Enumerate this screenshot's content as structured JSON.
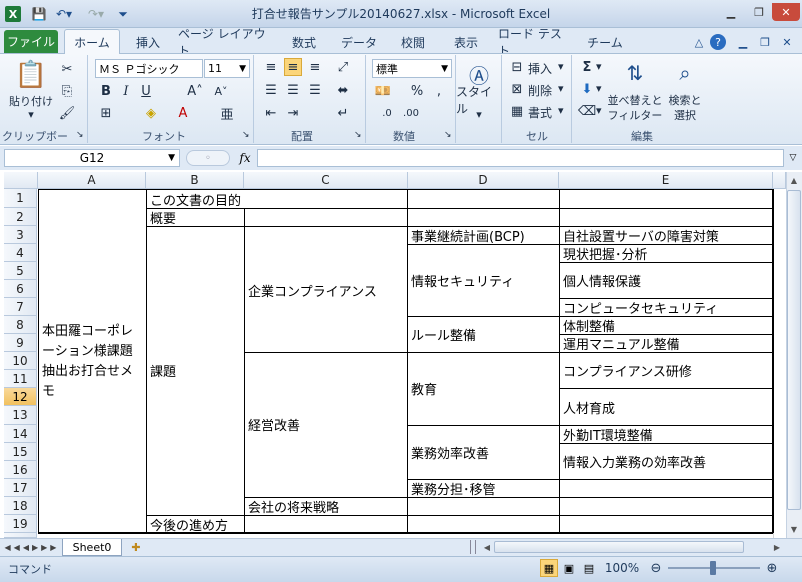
{
  "window": {
    "title": "打合せ報告サンプル20140627.xlsx - Microsoft Excel"
  },
  "ribbon_tabs": [
    "ファイル",
    "ホーム",
    "挿入",
    "ページ レイアウト",
    "数式",
    "データ",
    "校閲",
    "表示",
    "ロード テスト",
    "チーム"
  ],
  "ribbon": {
    "clipboard": {
      "label": "クリップボード",
      "paste": "貼り付け"
    },
    "font": {
      "label": "フォント",
      "name": "ＭＳ Ｐゴシック",
      "size": "11"
    },
    "alignment": {
      "label": "配置"
    },
    "number": {
      "label": "数値",
      "format": "標準"
    },
    "style": {
      "label": "スタイル",
      "button": "スタイル"
    },
    "cells": {
      "label": "セル",
      "insert": "挿入",
      "delete": "削除",
      "format": "書式"
    },
    "editing": {
      "label": "編集",
      "sort_line1": "並べ替えと",
      "sort_line2": "フィルター",
      "find_line1": "検索と",
      "find_line2": "選択"
    }
  },
  "formula_bar": {
    "name_box": "G12",
    "fx": "fx",
    "content": ""
  },
  "columns": [
    "A",
    "B",
    "C",
    "D",
    "E"
  ],
  "rows": [
    "1",
    "2",
    "3",
    "4",
    "5",
    "6",
    "7",
    "8",
    "9",
    "10",
    "11",
    "12",
    "13",
    "14",
    "15",
    "16",
    "17",
    "18",
    "19"
  ],
  "selected_row": "12",
  "cells": {
    "a_merged": "本田羅コーポレーション様課題抽出お打合せメモ",
    "b1": "この文書の目的",
    "b2": "概要",
    "b_issues": "課題",
    "b19": "今後の進め方",
    "c_compliance": "企業コンプライアンス",
    "c_mgmt": "経営改善",
    "c18": "会社の将来戦略",
    "d3": "事業継続計画(BCP)",
    "d_infosec": "情報セキュリティ",
    "d_rules": "ルール整備",
    "d_edu": "教育",
    "d_eff": "業務効率改善",
    "d17": "業務分担･移管",
    "e3": "自社設置サーバの障害対策",
    "e4": "現状把握･分析",
    "e_privacy": "個人情報保護",
    "e7": "コンピュータセキュリティ",
    "e8": "体制整備",
    "e9": "運用マニュアル整備",
    "e_comp_training": "コンプライアンス研修",
    "e_hr": "人材育成",
    "e14": "外勤IT環境整備",
    "e_input": "情報入力業務の効率改善"
  },
  "sheet_tabs": [
    "Sheet0"
  ],
  "status": {
    "mode": "コマンド",
    "zoom": "100%"
  }
}
